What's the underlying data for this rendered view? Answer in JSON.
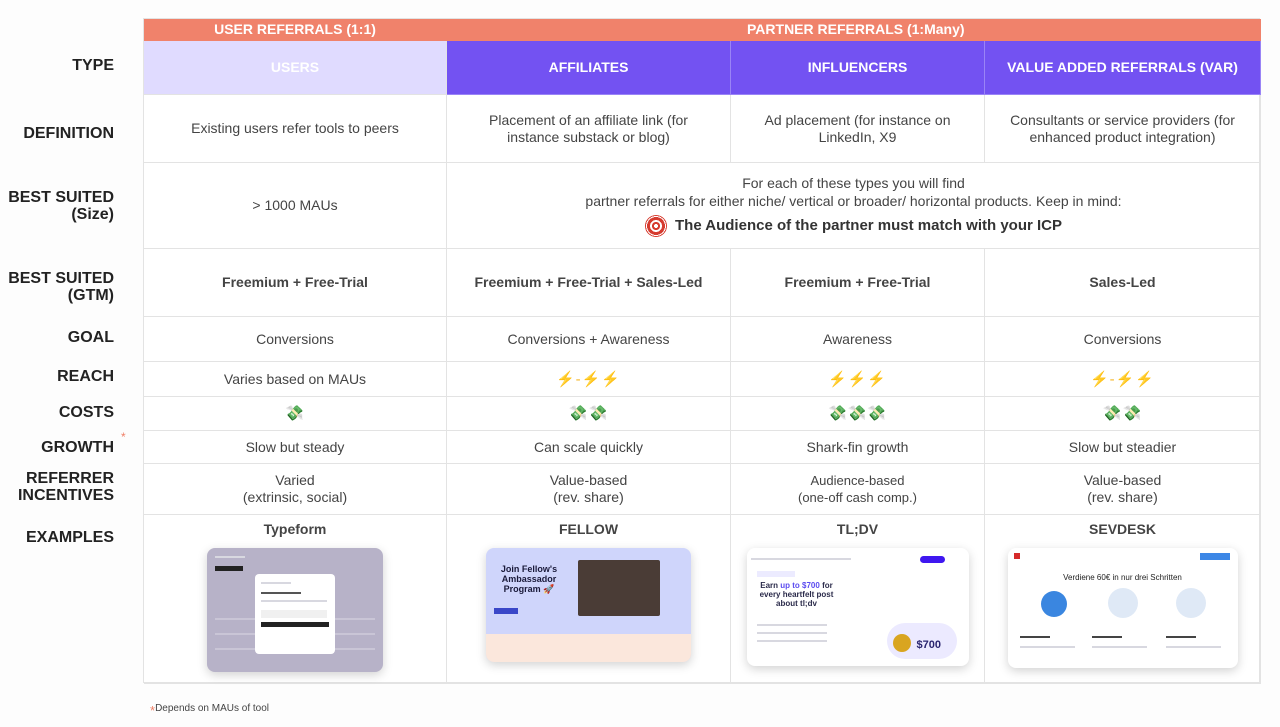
{
  "row_labels": {
    "type": "TYPE",
    "definition": "DEFINITION",
    "size_1": "BEST SUITED",
    "size_2": "(Size)",
    "gtm_1": "BEST SUITED",
    "gtm_2": "(GTM)",
    "goal": "GOAL",
    "reach": "REACH",
    "costs": "COSTS",
    "growth": "GROWTH",
    "growth_marker": "*",
    "incentives_1": "REFERRER",
    "incentives_2": "INCENTIVES",
    "examples": "EXAMPLES"
  },
  "groups": {
    "user": "USER REFERRALS (1:1)",
    "partner": "PARTNER REFERRALS (1:Many)"
  },
  "colors": {
    "group_header": "#f0826b",
    "users_header": "#e0dbff",
    "partner_header": "#7352f2"
  },
  "columns": [
    {
      "type": "USERS",
      "definition": "Existing users refer tools to peers",
      "size": "> 1000 MAUs",
      "gtm": "Freemium + Free-Trial",
      "goal": "Conversions",
      "reach": "Varies based on MAUs",
      "costs": "💸",
      "growth": "Slow but steady",
      "incentives_1": "Varied",
      "incentives_2": "(extrinsic, social)",
      "example": "Typeform"
    },
    {
      "type": "AFFILIATES",
      "definition": "Placement of an affiliate link (for instance substack or blog)",
      "gtm": "Freemium + Free-Trial + Sales-Led",
      "goal": "Conversions + Awareness",
      "reach": "⚡-⚡⚡",
      "costs": "💸💸",
      "growth": "Can scale quickly",
      "incentives_1": "Value-based",
      "incentives_2": "(rev. share)",
      "example": "FELLOW"
    },
    {
      "type": "INFLUENCERS",
      "definition": "Ad placement (for instance on LinkedIn, X9",
      "gtm": "Freemium + Free-Trial",
      "goal": "Awareness",
      "reach": "⚡⚡⚡",
      "costs": "💸💸💸",
      "growth": "Shark-fin growth",
      "incentives_1": "Audience-based",
      "incentives_2": "(one-off cash comp.)",
      "example": "TL;DV"
    },
    {
      "type": "VALUE ADDED REFERRALS (VAR)",
      "definition": "Consultants or service providers (for enhanced product integration)",
      "gtm": "Sales-Led",
      "goal": "Conversions",
      "reach": "⚡-⚡⚡",
      "costs": "💸💸",
      "growth": "Slow but steadier",
      "incentives_1": "Value-based",
      "incentives_2": "(rev. share)",
      "example": "SEVDESK"
    }
  ],
  "partner_size_note": {
    "line1": "For each of these types you will find",
    "line2": "partner referrals for either niche/ vertical or broader/ horizontal products. Keep in mind:",
    "icon": "target-icon",
    "highlight": "The Audience of the partner must match with your ICP"
  },
  "screenshots": {
    "fellow_title": "Join Fellow's Ambassador Program 🚀",
    "tldv_title_a": "Earn ",
    "tldv_title_b": "up to $700",
    "tldv_title_c": " for every heartfelt post about tl;dv",
    "tldv_amount": "$700",
    "sevdesk_title": "Verdiene 60€ in nur drei Schritten"
  },
  "footnote": {
    "marker": "*",
    "text": "Depends on MAUs of tool"
  }
}
